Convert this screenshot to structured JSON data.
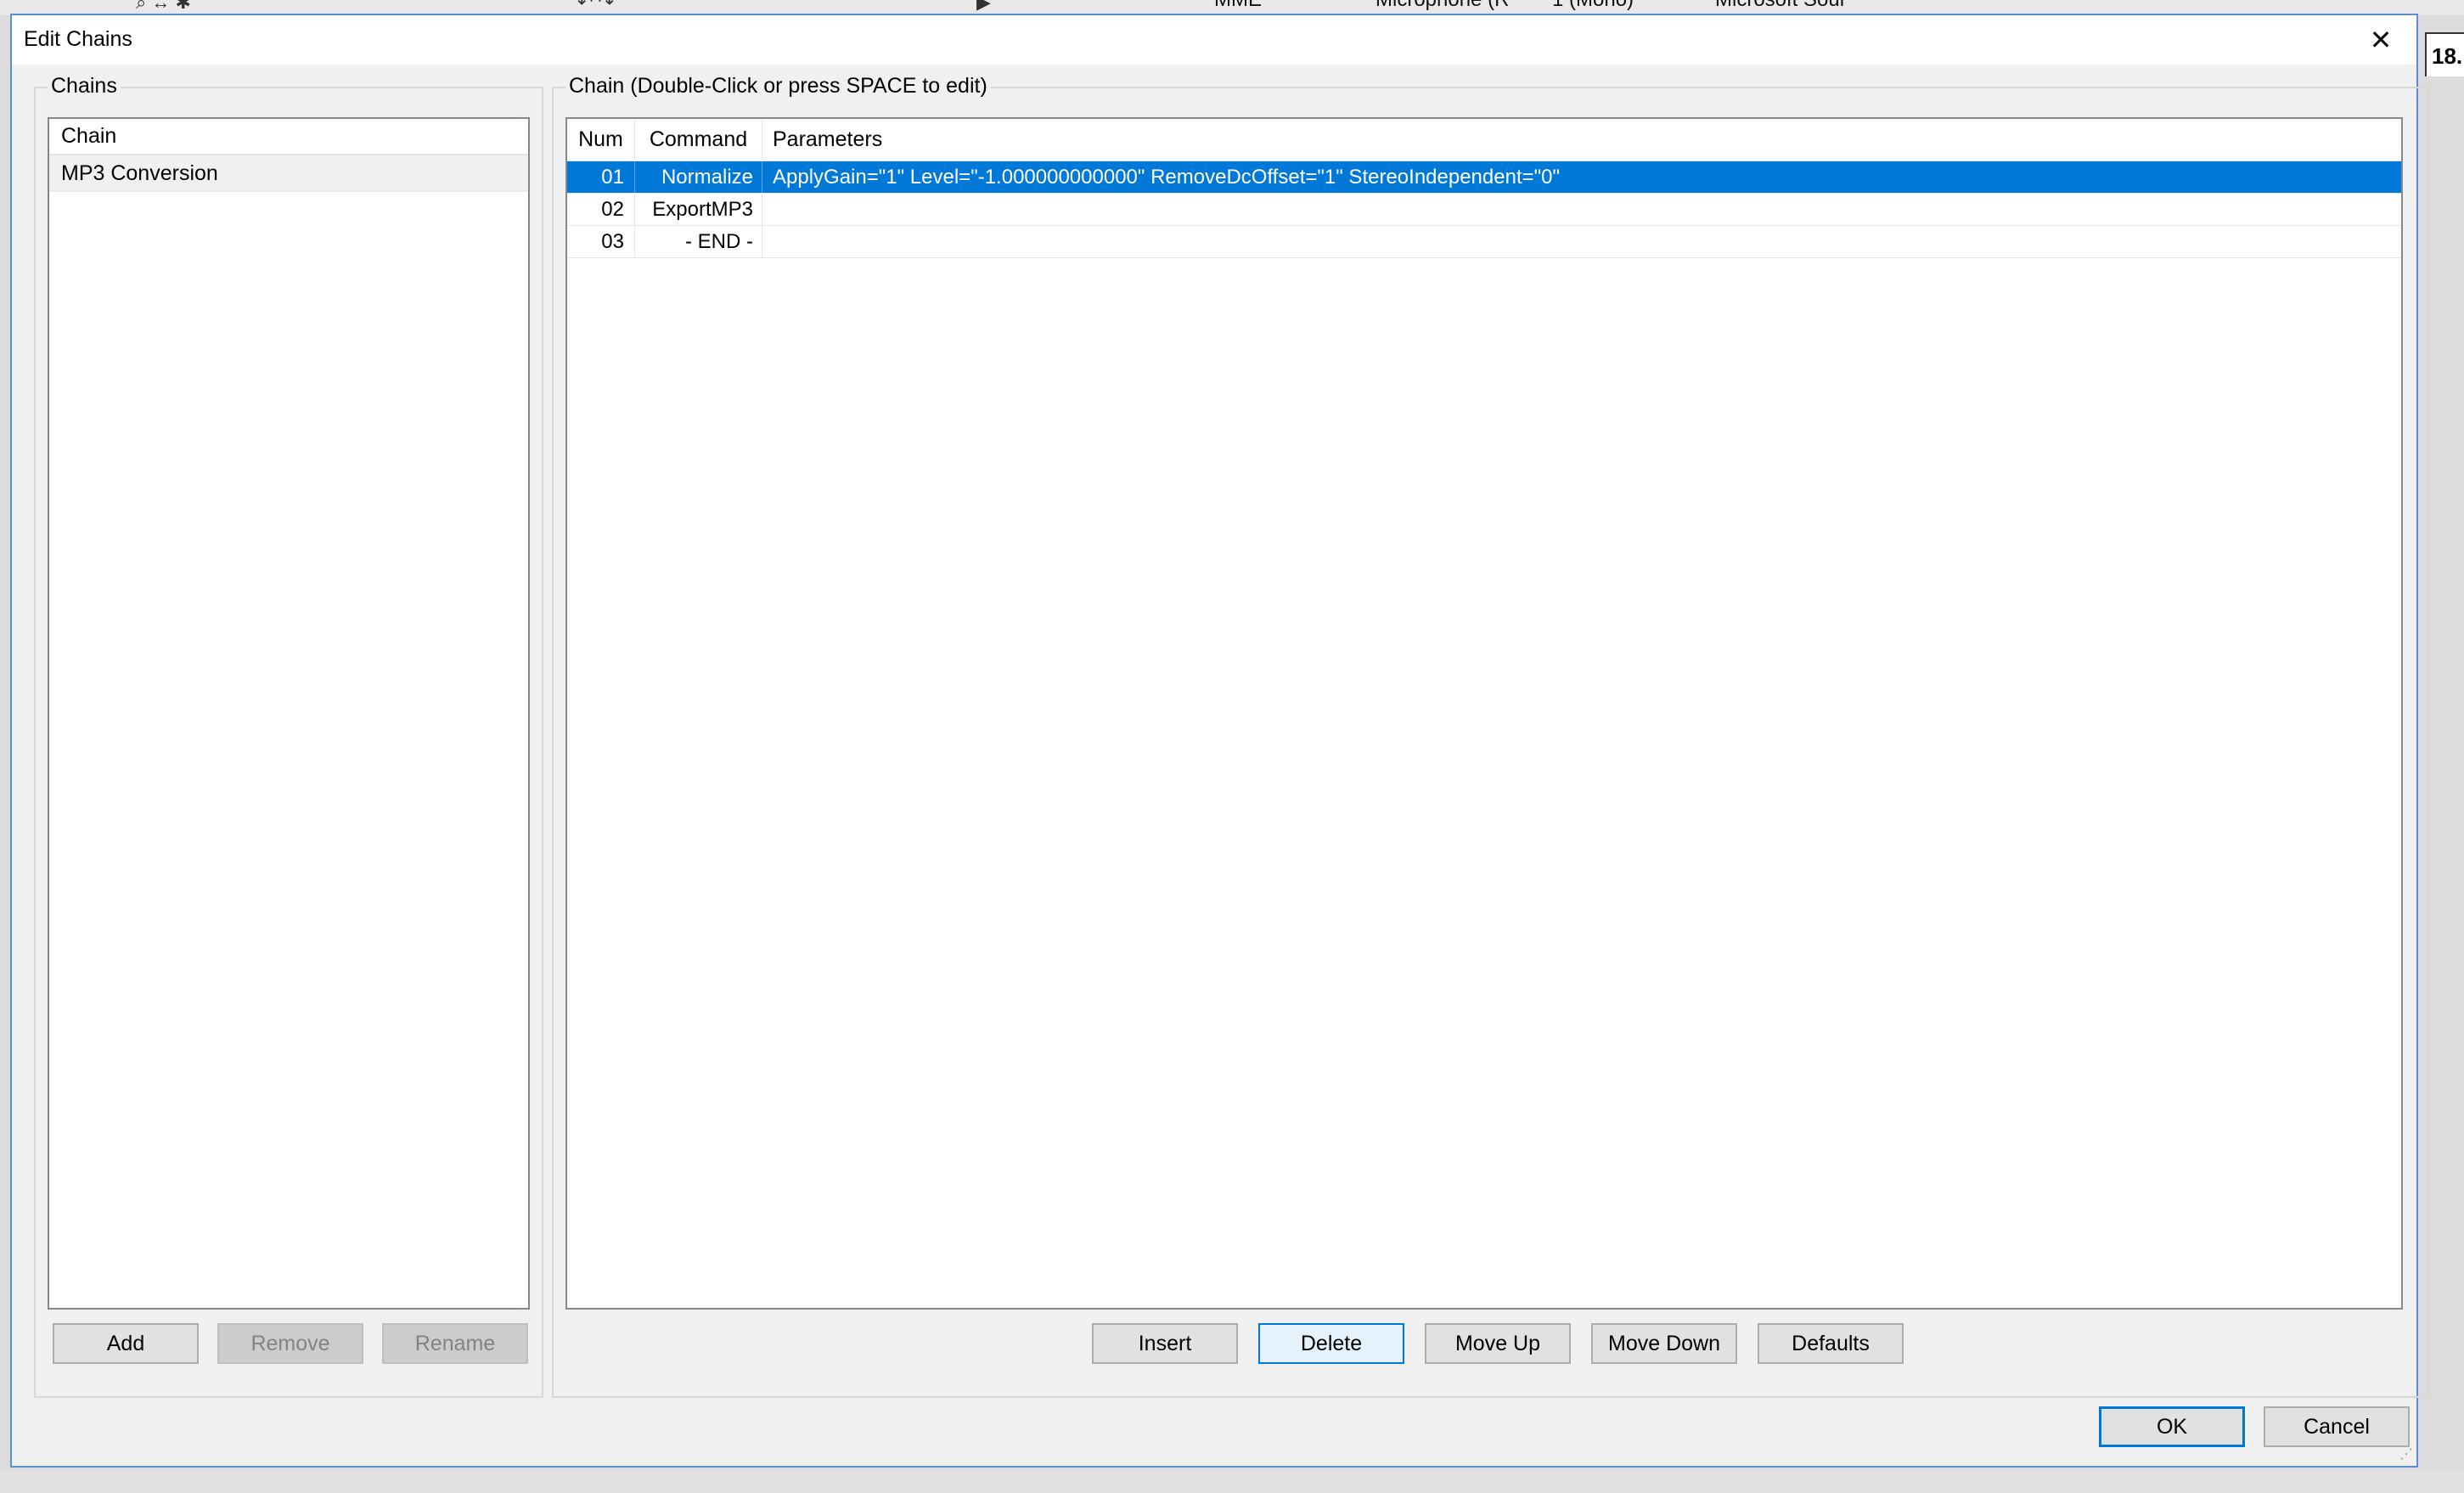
{
  "host_toolbar": {
    "audio_host": "MME",
    "recording_device": "Microphone (R",
    "channels": "1 (Mono)",
    "playback_device": "Microsoft Sour",
    "right_clip_label": "18."
  },
  "dialog": {
    "title": "Edit Chains",
    "close_glyph": "✕"
  },
  "chains_panel": {
    "label": "Chains",
    "list_header": "Chain",
    "items": [
      "MP3 Conversion"
    ],
    "buttons": {
      "add": "Add",
      "remove": "Remove",
      "rename": "Rename"
    }
  },
  "chain_panel": {
    "label": "Chain (Double-Click or press SPACE to edit)",
    "columns": {
      "num": "Num",
      "command": "Command",
      "parameters": "Parameters"
    },
    "rows": [
      {
        "num": "01",
        "command": "Normalize",
        "parameters": "ApplyGain=\"1\" Level=\"-1.000000000000\" RemoveDcOffset=\"1\" StereoIndependent=\"0\""
      },
      {
        "num": "02",
        "command": "ExportMP3",
        "parameters": ""
      },
      {
        "num": "03",
        "command": "- END -",
        "parameters": ""
      }
    ],
    "buttons": {
      "insert": "Insert",
      "delete": "Delete",
      "move_up": "Move Up",
      "move_down": "Move Down",
      "defaults": "Defaults"
    }
  },
  "footer": {
    "ok": "OK",
    "cancel": "Cancel"
  },
  "colors": {
    "selection": "#0078d7",
    "dialog_border": "#5b8fd1",
    "background": "#f0f0f0"
  }
}
